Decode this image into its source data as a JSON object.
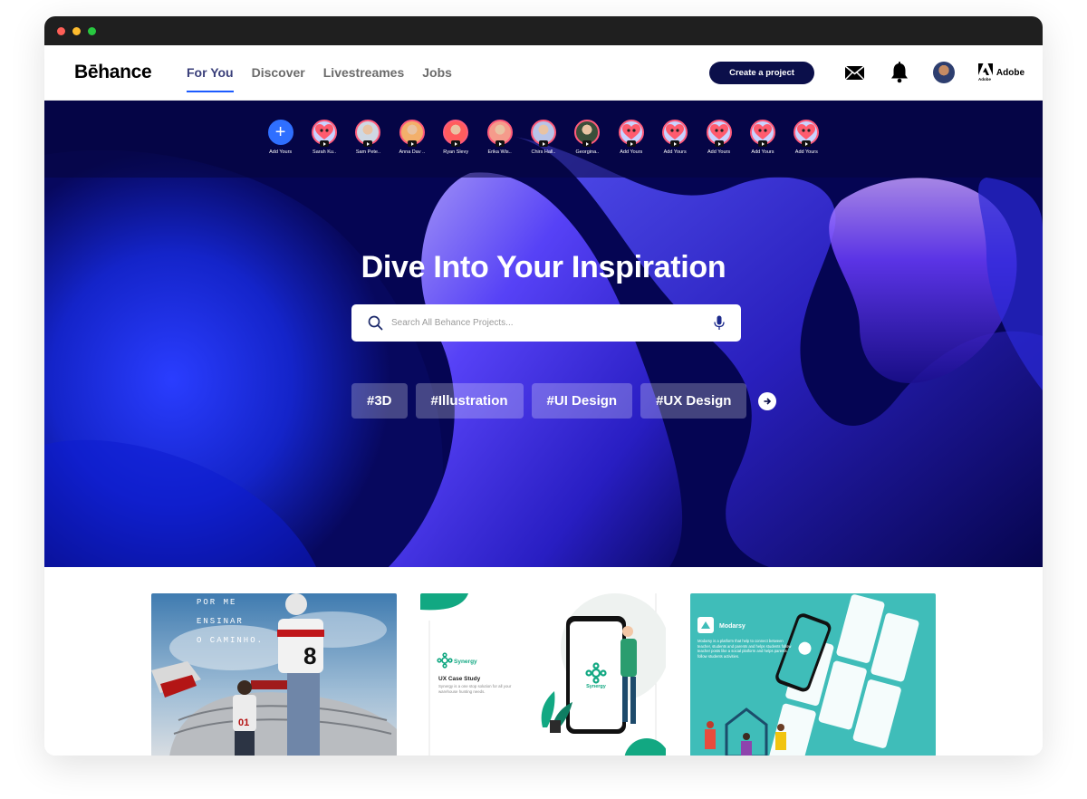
{
  "brand": {
    "logo": "Bēhance",
    "accent": "#1c5bff",
    "navy": "#0b0f4a"
  },
  "nav": {
    "tabs": [
      {
        "label": "For You",
        "active": true
      },
      {
        "label": "Discover",
        "active": false
      },
      {
        "label": "Livestreames",
        "active": false
      },
      {
        "label": "Jobs",
        "active": false
      }
    ],
    "create_label": "Create a project",
    "adobe_label": "Adobe",
    "adobe_mark_text": "Adobe",
    "icons": [
      "mail-icon",
      "bell-icon",
      "user-avatar",
      "adobe-logo-icon"
    ]
  },
  "stories": [
    {
      "label": "Add Yours",
      "kind": "add"
    },
    {
      "label": "Sarah Ku..",
      "kind": "heart"
    },
    {
      "label": "Sam Pete..",
      "kind": "person"
    },
    {
      "label": "Anna Dav ..",
      "kind": "person"
    },
    {
      "label": "Ryan Slevy",
      "kind": "person"
    },
    {
      "label": "Erika Wis..",
      "kind": "person"
    },
    {
      "label": "Chirs Hall..",
      "kind": "person"
    },
    {
      "label": "Georgina..",
      "kind": "person"
    },
    {
      "label": "Add Yours",
      "kind": "heart"
    },
    {
      "label": "Add Yours",
      "kind": "heart"
    },
    {
      "label": "Add Yours",
      "kind": "heart"
    },
    {
      "label": "Add Yours",
      "kind": "heart"
    },
    {
      "label": "Add Yours",
      "kind": "heart"
    }
  ],
  "hero": {
    "title": "Dive Into Your Inspiration",
    "search_placeholder": "Search All Behance Projects...",
    "tags": [
      "#3D",
      "#Illustration",
      "#UI Design",
      "#UX Design"
    ]
  },
  "cards": [
    {
      "lines": [
        "POR ME",
        "ENSINAR",
        "O CAMINHO."
      ],
      "jersey_number": "8",
      "kid_number": "01"
    },
    {
      "brand": "Synergy",
      "heading": "UX Case Study",
      "desc": "Synergy is a one stop solution for all your warehouse hunting needs.",
      "phone_label": "Synergy"
    },
    {
      "brand": "Modarsy",
      "desc": "Modarsy is a platform that help to connect between teacher, students and parents and helps students follow teacher posts like a social platform and helps parents follow students activities."
    }
  ]
}
